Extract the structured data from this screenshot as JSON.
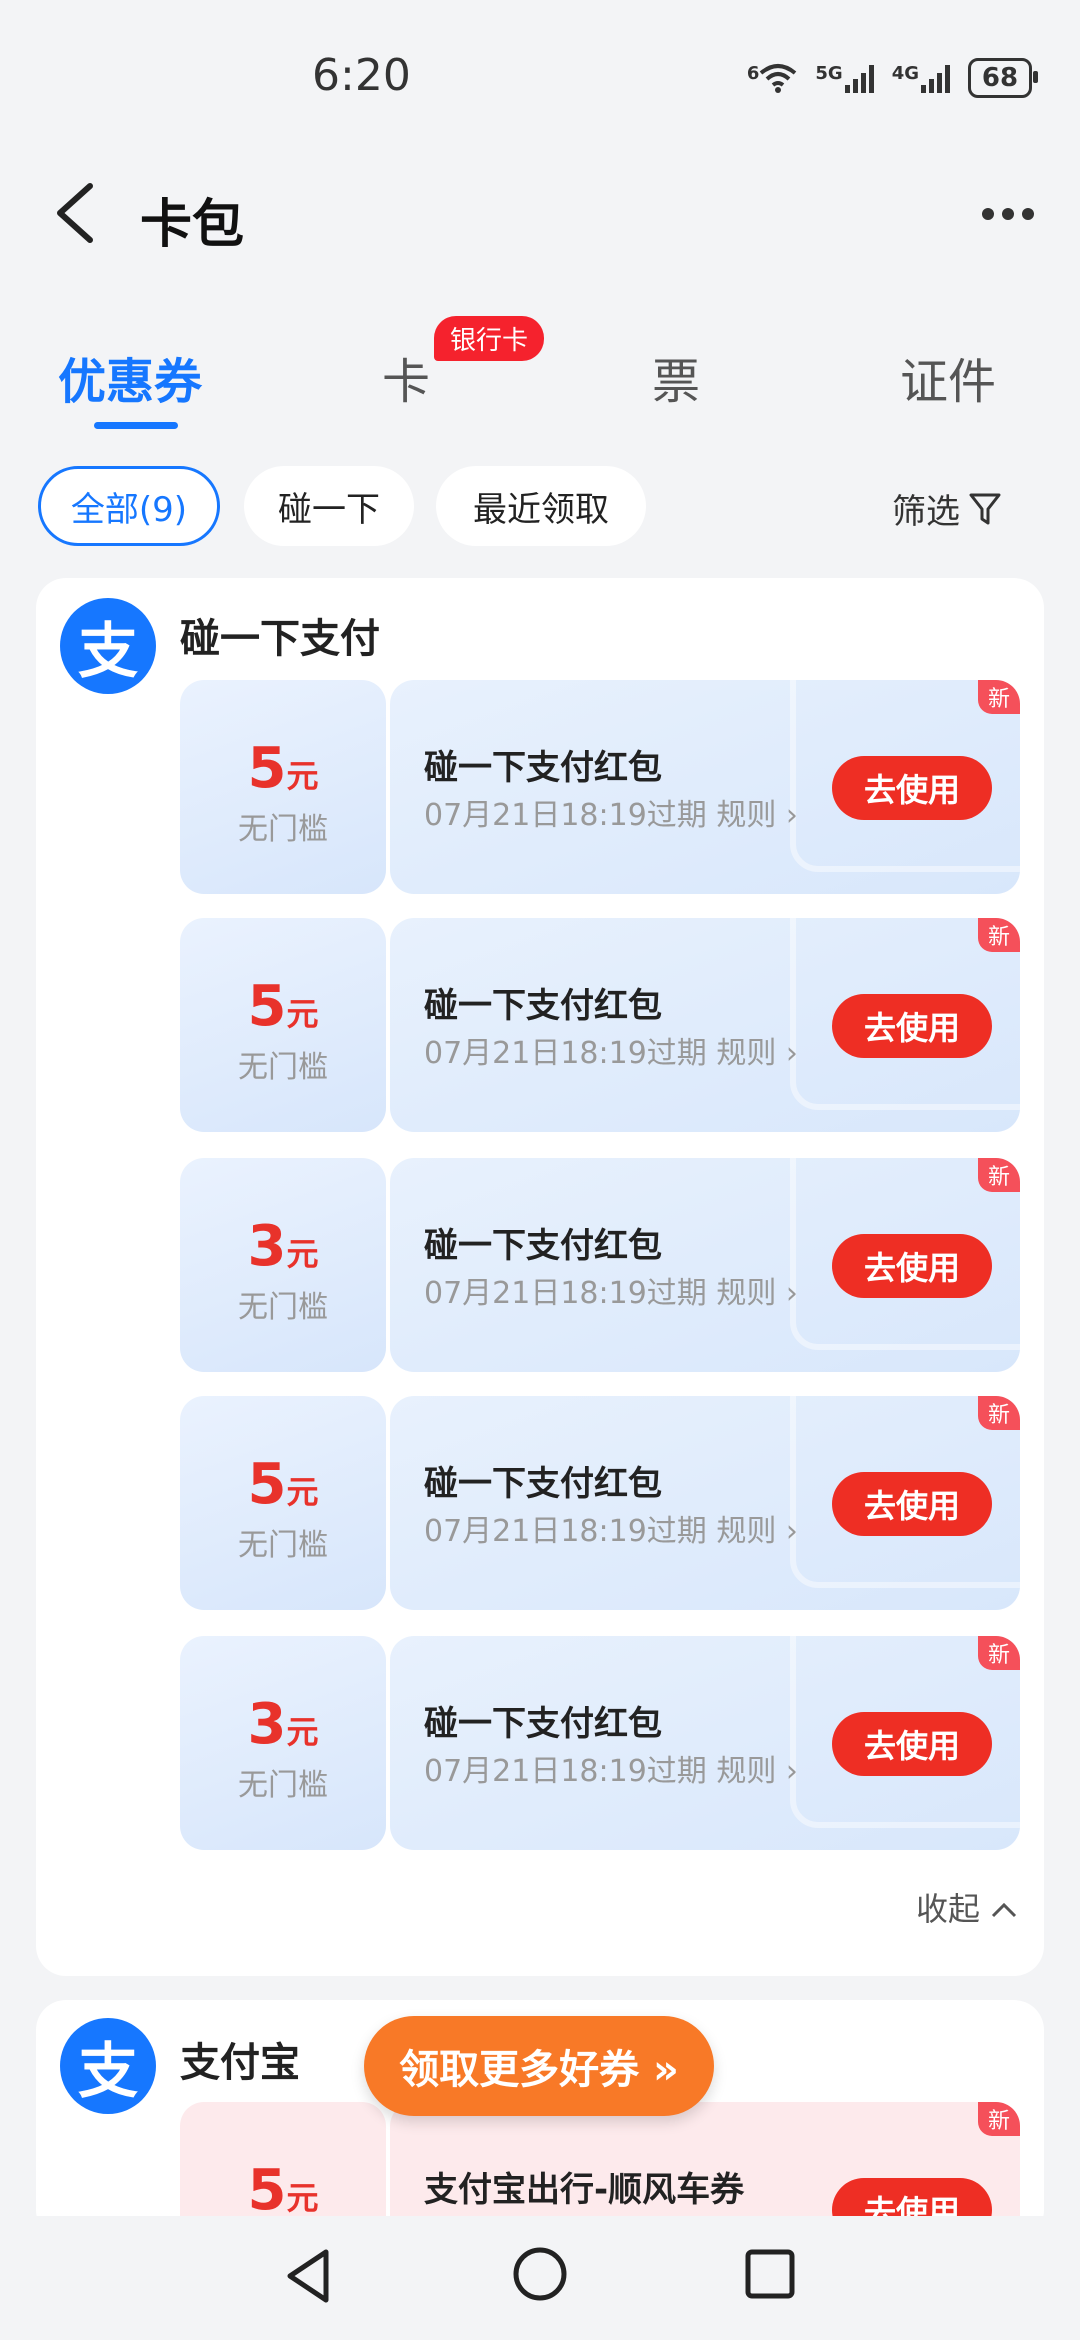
{
  "status": {
    "time": "6:20",
    "battery": "68",
    "net1": "5G",
    "net2": "4G",
    "wifi_num": "6"
  },
  "header": {
    "title": "卡包"
  },
  "tabs": [
    {
      "label": "优惠券",
      "active": true
    },
    {
      "label": "卡",
      "badge": "银行卡"
    },
    {
      "label": "票"
    },
    {
      "label": "证件"
    }
  ],
  "filters": {
    "all": "全部(9)",
    "tap": "碰一下",
    "recent": "最近领取",
    "filter": "筛选"
  },
  "group1": {
    "logo": "支",
    "title": "碰一下支付",
    "coupons": [
      {
        "amount": "5",
        "unit": "元",
        "sub": "无门槛",
        "name": "碰一下支付红包",
        "expire": "07月21日18:19过期",
        "rule": "规则",
        "btn": "去使用",
        "tag": "新"
      },
      {
        "amount": "5",
        "unit": "元",
        "sub": "无门槛",
        "name": "碰一下支付红包",
        "expire": "07月21日18:19过期",
        "rule": "规则",
        "btn": "去使用",
        "tag": "新"
      },
      {
        "amount": "3",
        "unit": "元",
        "sub": "无门槛",
        "name": "碰一下支付红包",
        "expire": "07月21日18:19过期",
        "rule": "规则",
        "btn": "去使用",
        "tag": "新"
      },
      {
        "amount": "5",
        "unit": "元",
        "sub": "无门槛",
        "name": "碰一下支付红包",
        "expire": "07月21日18:19过期",
        "rule": "规则",
        "btn": "去使用",
        "tag": "新"
      },
      {
        "amount": "3",
        "unit": "元",
        "sub": "无门槛",
        "name": "碰一下支付红包",
        "expire": "07月21日18:19过期",
        "rule": "规则",
        "btn": "去使用",
        "tag": "新"
      }
    ],
    "collapse": "收起"
  },
  "group2": {
    "logo": "支",
    "title": "支付宝",
    "coupon": {
      "amount": "5",
      "unit": "元",
      "name": "支付宝出行-顺风车券",
      "btn": "去使用",
      "tag": "新"
    }
  },
  "float_button": "领取更多好券 »",
  "colors": {
    "accent": "#1677ff",
    "red": "#ee2e24",
    "orange": "#f87927"
  }
}
